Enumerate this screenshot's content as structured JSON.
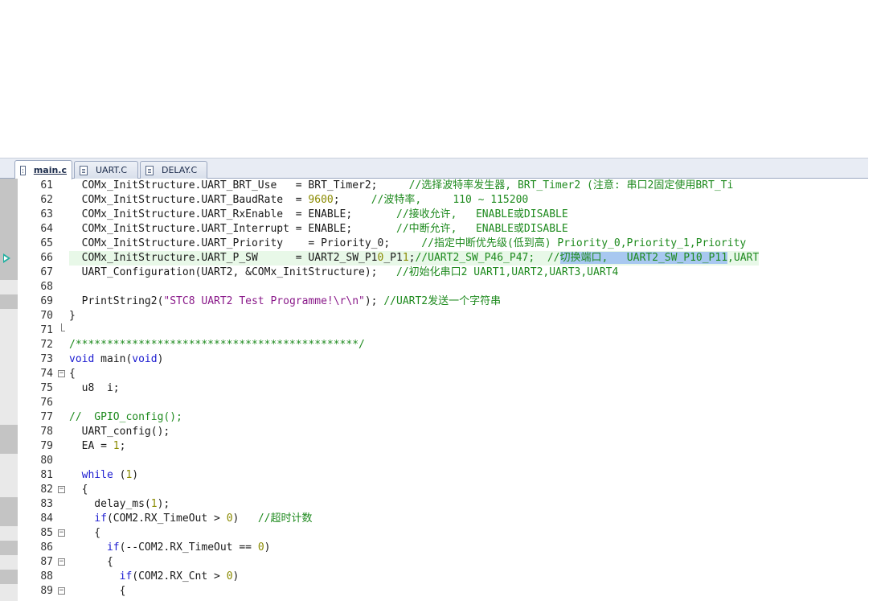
{
  "tabs": [
    {
      "label": "main.c",
      "active": true
    },
    {
      "label": "UART.C",
      "active": false
    },
    {
      "label": "DELAY.C",
      "active": false
    }
  ],
  "colors": {
    "keyword": "#1b1bd0",
    "comment": "#1e8a1e",
    "number": "#8a8a00",
    "string": "#8a1a8a",
    "selection": "#a8c8f0",
    "current_line": "#e8f8e8"
  },
  "lines": [
    {
      "num": "61",
      "text": "  COMx_InitStructure.UART_BRT_Use   = BRT_Timer2;     //选择波特率发生器, BRT_Timer2 (注意: 串口2固定使用BRT_Ti"
    },
    {
      "num": "62",
      "text": "  COMx_InitStructure.UART_BaudRate  = 9600;     //波特率,     110 ~ 115200"
    },
    {
      "num": "63",
      "text": "  COMx_InitStructure.UART_RxEnable  = ENABLE;       //接收允许,   ENABLE或DISABLE"
    },
    {
      "num": "64",
      "text": "  COMx_InitStructure.UART_Interrupt = ENABLE;       //中断允许,   ENABLE或DISABLE"
    },
    {
      "num": "65",
      "text": "  COMx_InitStructure.UART_Priority    = Priority_0;     //指定中断优先级(低到高) Priority_0,Priority_1,Priority"
    },
    {
      "num": "66",
      "text": "  COMx_InitStructure.UART_P_SW      = UART2_SW_P10_P11;//UART2_SW_P46_P47;  //切换端口,   UART2_SW_P10_P11,UART"
    },
    {
      "num": "67",
      "text": "  UART_Configuration(UART2, &COMx_InitStructure);   //初始化串口2 UART1,UART2,UART3,UART4"
    },
    {
      "num": "68",
      "text": ""
    },
    {
      "num": "69",
      "text": "  PrintString2(\"STC8 UART2 Test Programme!\\r\\n\"); //UART2发送一个字符串"
    },
    {
      "num": "70",
      "text": "}"
    },
    {
      "num": "71",
      "text": ""
    },
    {
      "num": "72",
      "text": "/*********************************************/"
    },
    {
      "num": "73",
      "text": "void main(void)"
    },
    {
      "num": "74",
      "text": "{"
    },
    {
      "num": "75",
      "text": "  u8  i;"
    },
    {
      "num": "76",
      "text": ""
    },
    {
      "num": "77",
      "text": "//  GPIO_config();"
    },
    {
      "num": "78",
      "text": "  UART_config();"
    },
    {
      "num": "79",
      "text": "  EA = 1;"
    },
    {
      "num": "80",
      "text": ""
    },
    {
      "num": "81",
      "text": "  while (1)"
    },
    {
      "num": "82",
      "text": "  {"
    },
    {
      "num": "83",
      "text": "    delay_ms(1);"
    },
    {
      "num": "84",
      "text": "    if(COM2.RX_TimeOut > 0)   //超时计数"
    },
    {
      "num": "85",
      "text": "    {"
    },
    {
      "num": "86",
      "text": "      if(--COM2.RX_TimeOut == 0)"
    },
    {
      "num": "87",
      "text": "      {"
    },
    {
      "num": "88",
      "text": "        if(COM2.RX_Cnt > 0)"
    },
    {
      "num": "89",
      "text": "        {"
    }
  ],
  "highlights": {
    "current_line": "66",
    "selected_text": "切换端口,   UART2_SW_P10_P11"
  }
}
